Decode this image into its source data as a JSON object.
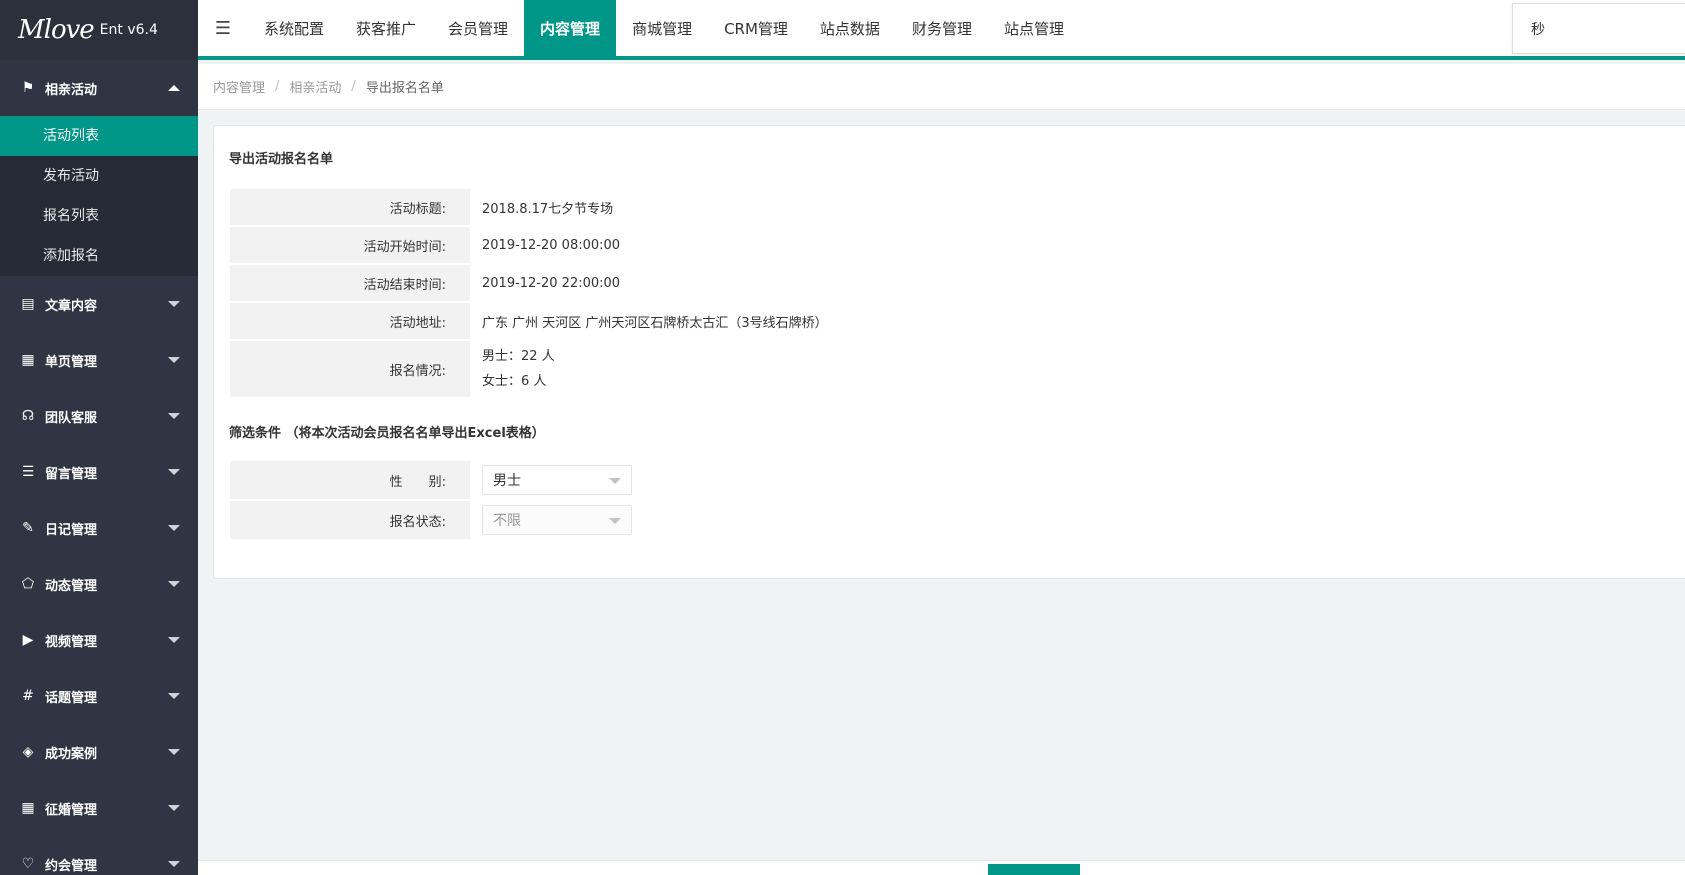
{
  "app": {
    "logo_text": "Mlove",
    "version": "Ent v6.4"
  },
  "sidebar": {
    "active_group": {
      "label": "相亲活动",
      "icon": "flag-icon",
      "items": [
        {
          "label": "活动列表",
          "active": true
        },
        {
          "label": "发布活动"
        },
        {
          "label": "报名列表"
        },
        {
          "label": "添加报名"
        }
      ]
    },
    "groups": [
      {
        "label": "文章内容",
        "icon": "document-icon",
        "glyph": "▤"
      },
      {
        "label": "单页管理",
        "icon": "page-icon",
        "glyph": "▦"
      },
      {
        "label": "团队客服",
        "icon": "headset-icon",
        "glyph": "☊"
      },
      {
        "label": "留言管理",
        "icon": "message-icon",
        "glyph": "☰"
      },
      {
        "label": "日记管理",
        "icon": "diary-icon",
        "glyph": "✎"
      },
      {
        "label": "动态管理",
        "icon": "moment-icon",
        "glyph": "⬠"
      },
      {
        "label": "视频管理",
        "icon": "play-icon",
        "glyph": "▶"
      },
      {
        "label": "话题管理",
        "icon": "hash-icon",
        "glyph": "#"
      },
      {
        "label": "成功案例",
        "icon": "layers-icon",
        "glyph": "◈"
      },
      {
        "label": "征婚管理",
        "icon": "grid-icon",
        "glyph": "▦"
      },
      {
        "label": "约会管理",
        "icon": "date-icon",
        "glyph": "♡"
      }
    ]
  },
  "topnav": {
    "fold_glyph": "☰",
    "items": [
      {
        "label": "系统配置"
      },
      {
        "label": "获客推广"
      },
      {
        "label": "会员管理"
      },
      {
        "label": "内容管理",
        "active": true
      },
      {
        "label": "商城管理"
      },
      {
        "label": "CRM管理"
      },
      {
        "label": "站点数据"
      },
      {
        "label": "财务管理"
      },
      {
        "label": "站点管理"
      }
    ],
    "search_value": "秒"
  },
  "breadcrumb": [
    "内容管理",
    "相亲活动",
    "导出报名名单"
  ],
  "export": {
    "title": "导出活动报名名单",
    "rows": [
      {
        "label": "活动标题:",
        "value": "2018.8.17七夕节专场"
      },
      {
        "label": "活动开始时间:",
        "value": "2019-12-20 08:00:00"
      },
      {
        "label": "活动结束时间:",
        "value": "2019-12-20 22:00:00"
      },
      {
        "label": "活动地址:",
        "value": "广东 广州 天河区 广州天河区石牌桥太古汇（3号线石牌桥）"
      }
    ],
    "signup": {
      "label": "报名情况:",
      "male": "男士：22 人",
      "female": "女士：6 人"
    }
  },
  "filter": {
    "title": "筛选条件 （将本次活动会员报名名单导出Excel表格）",
    "gender": {
      "label": "性　　别:",
      "value": "男士"
    },
    "status": {
      "label": "报名状态:",
      "value": "不限"
    }
  },
  "colors": {
    "accent": "#009688",
    "sidebar_bg": "#2f3542"
  }
}
